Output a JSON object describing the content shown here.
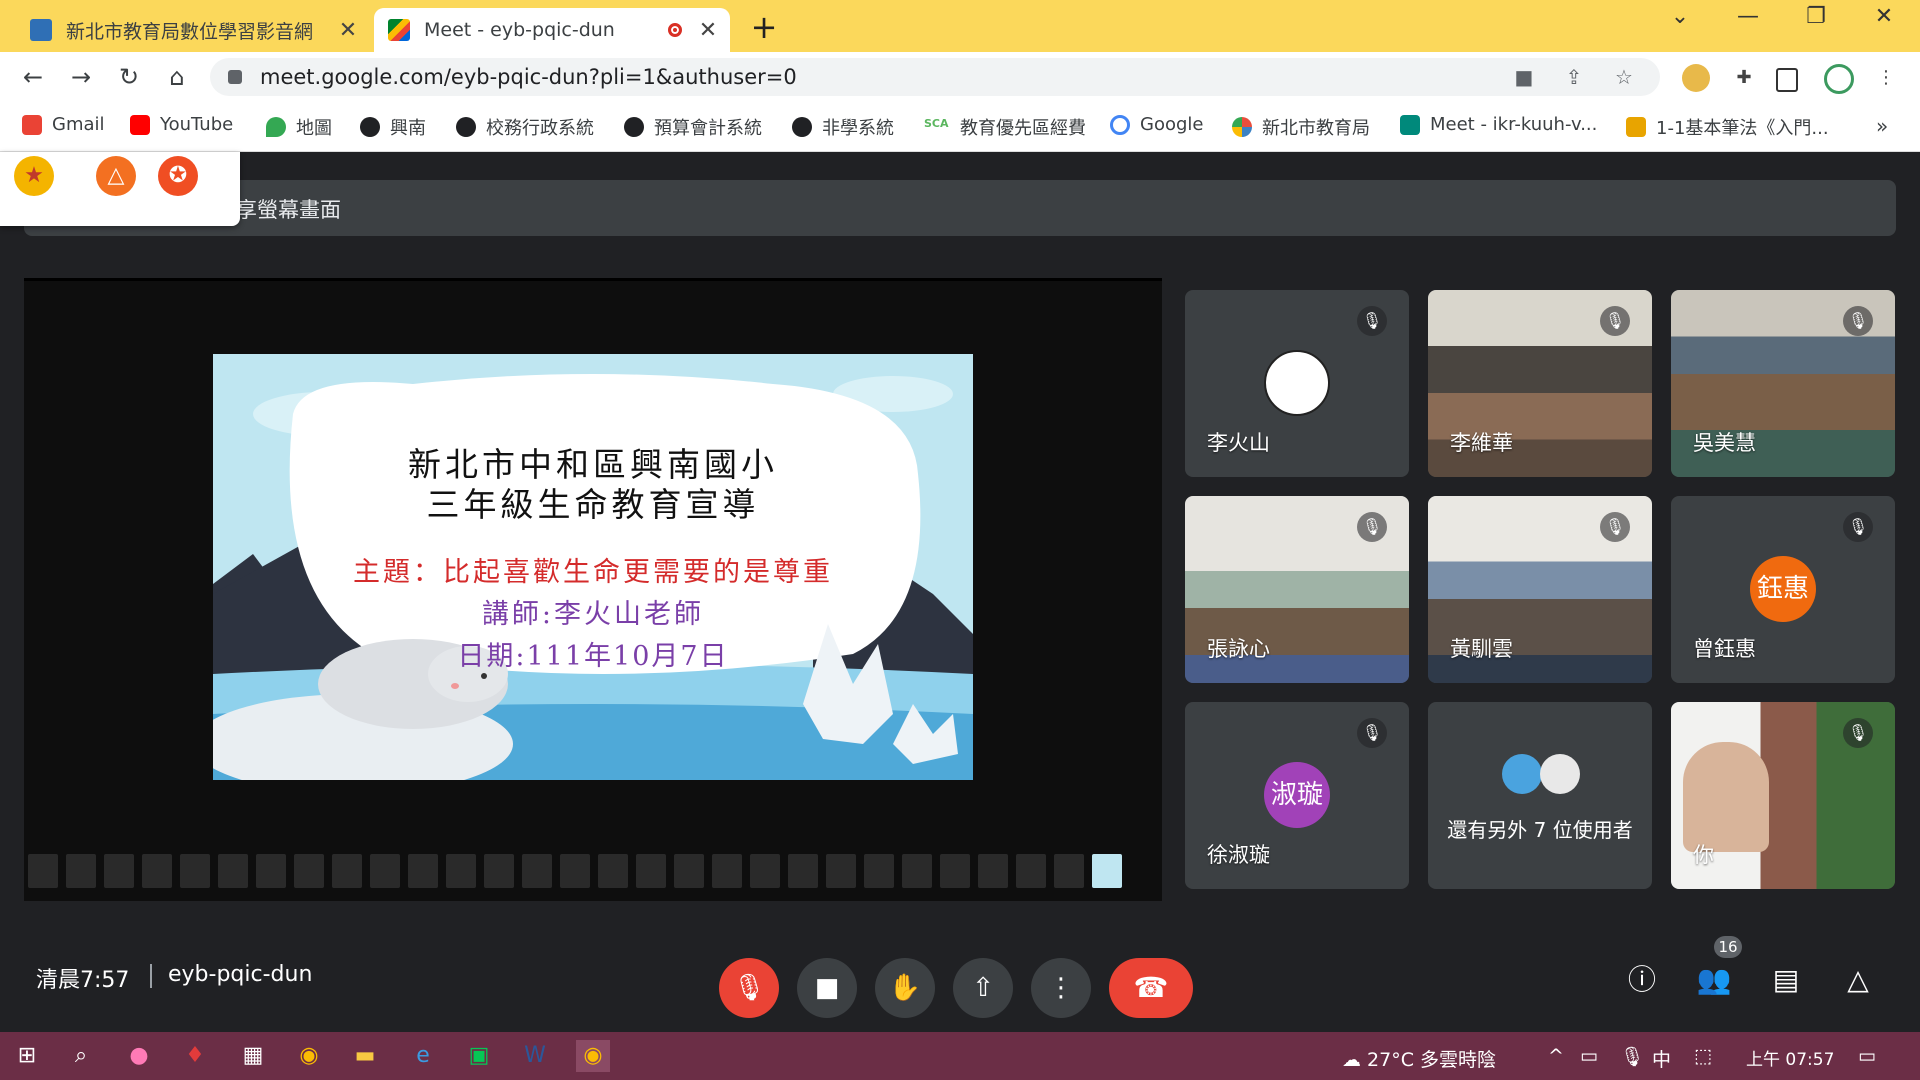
{
  "browser": {
    "tabs": [
      {
        "title": "新北市教育局數位學習影音網",
        "active": false
      },
      {
        "title": "Meet - eyb-pqic-dun",
        "active": true,
        "recording": true
      }
    ],
    "url": "meet.google.com/eyb-pqic-dun?pli=1&authuser=0",
    "bookmarks": [
      {
        "label": "Gmail",
        "color": "#ea4335"
      },
      {
        "label": "YouTube",
        "color": "#ff0000"
      },
      {
        "label": "地圖",
        "color": "#34a853"
      },
      {
        "label": "興南",
        "color": "#202124"
      },
      {
        "label": "校務行政系統",
        "color": "#202124"
      },
      {
        "label": "預算會計系統",
        "color": "#202124"
      },
      {
        "label": "非學系統",
        "color": "#202124"
      },
      {
        "label": "教育優先區經費",
        "color": "#5bb65f",
        "icon_text": "SCA"
      },
      {
        "label": "Google",
        "color": "#4285f4"
      },
      {
        "label": "新北市教育局",
        "color": "#e94e3c"
      },
      {
        "label": "Meet - ikr-kuuh-v...",
        "color": "#00897b"
      },
      {
        "label": "1-1基本筆法《入門...",
        "color": "#e8a400"
      }
    ],
    "more_bookmarks": "»"
  },
  "meet": {
    "share_banner": "享螢幕畫面",
    "slide": {
      "title_line1": "新北市中和區興南國小",
      "title_line2": "三年級生命教育宣導",
      "topic": "主題：比起喜歡生命更需要的是尊重",
      "speaker": "講師:李火山老師",
      "date": "日期:111年10月7日"
    },
    "participants": [
      {
        "name": "李火山",
        "type": "avatar-image",
        "muted": true
      },
      {
        "name": "李維華",
        "type": "video",
        "muted": true
      },
      {
        "name": "吳美慧",
        "type": "video",
        "muted": true
      },
      {
        "name": "張詠心",
        "type": "video",
        "muted": true
      },
      {
        "name": "黃馴雲",
        "type": "video",
        "muted": true
      },
      {
        "name": "曾鈺惠",
        "type": "initials",
        "initials": "鈺惠",
        "color": "#f06a0f",
        "muted": true
      },
      {
        "name": "徐淑璇",
        "type": "initials",
        "initials": "淑璇",
        "color": "#a142b8",
        "muted": true
      },
      {
        "name": "還有另外 7 位使用者",
        "type": "others"
      },
      {
        "name": "你",
        "type": "video",
        "muted": true
      }
    ],
    "time": "清晨7:57",
    "meeting_code": "eyb-pqic-dun",
    "participant_count": "16"
  },
  "taskbar": {
    "weather": "27°C 多雲時陰",
    "ime": "中",
    "clock": "上午 07:57"
  }
}
